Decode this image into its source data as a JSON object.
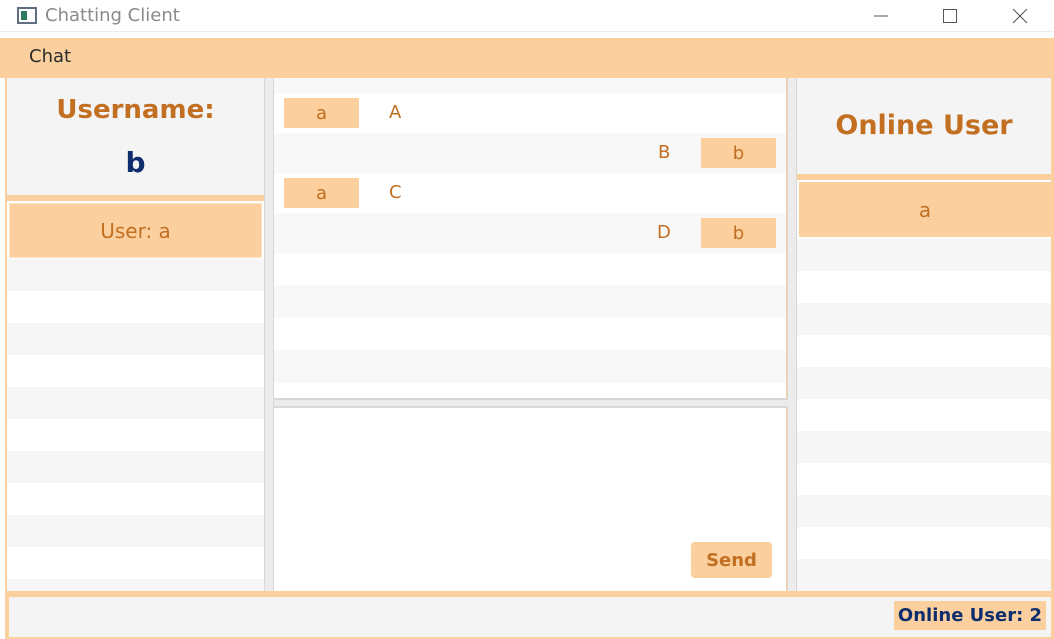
{
  "window": {
    "title": "Chatting Client"
  },
  "menu": {
    "items": [
      "Chat"
    ]
  },
  "left": {
    "username_label": "Username:",
    "username_value": "b",
    "users": [
      "User: a"
    ]
  },
  "chat": {
    "messages": [
      {
        "sender": "a",
        "text": "A",
        "side": "left"
      },
      {
        "sender": "b",
        "text": "B",
        "side": "right"
      },
      {
        "sender": "a",
        "text": "C",
        "side": "left"
      },
      {
        "sender": "b",
        "text": "D",
        "side": "right"
      }
    ],
    "input_value": "",
    "send_label": "Send"
  },
  "right": {
    "title": "Online User",
    "users": [
      "a"
    ]
  },
  "status": {
    "online_count_text": "Online User: 2"
  },
  "colors": {
    "accent": "#fbd09e",
    "accent_text": "#c26f22",
    "navy_text": "#0e2d6e"
  }
}
